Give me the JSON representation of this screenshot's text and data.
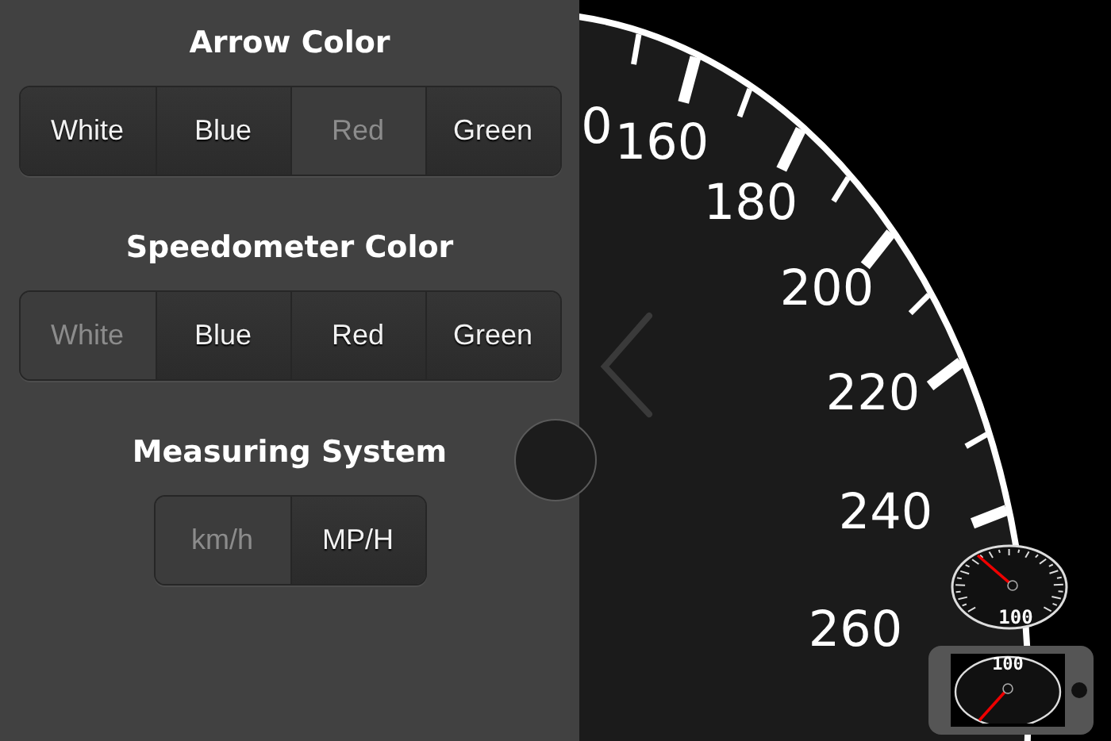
{
  "settings": {
    "sections": [
      {
        "title": "Arrow Color",
        "options": [
          {
            "label": "White",
            "selected": false
          },
          {
            "label": "Blue",
            "selected": false
          },
          {
            "label": "Red",
            "selected": true
          },
          {
            "label": "Green",
            "selected": false
          }
        ]
      },
      {
        "title": "Speedometer Color",
        "options": [
          {
            "label": "White",
            "selected": true
          },
          {
            "label": "Blue",
            "selected": false
          },
          {
            "label": "Red",
            "selected": false
          },
          {
            "label": "Green",
            "selected": false
          }
        ]
      },
      {
        "title": "Measuring System",
        "options": [
          {
            "label": "km/h",
            "selected": true
          },
          {
            "label": "MP/H",
            "selected": false
          }
        ]
      }
    ]
  },
  "speedometer": {
    "labels": [
      "0",
      "160",
      "180",
      "200",
      "220",
      "240",
      "260"
    ]
  },
  "previews": [
    {
      "kind": "gauge",
      "readout": "100"
    },
    {
      "kind": "phone",
      "readout": "100"
    }
  ]
}
